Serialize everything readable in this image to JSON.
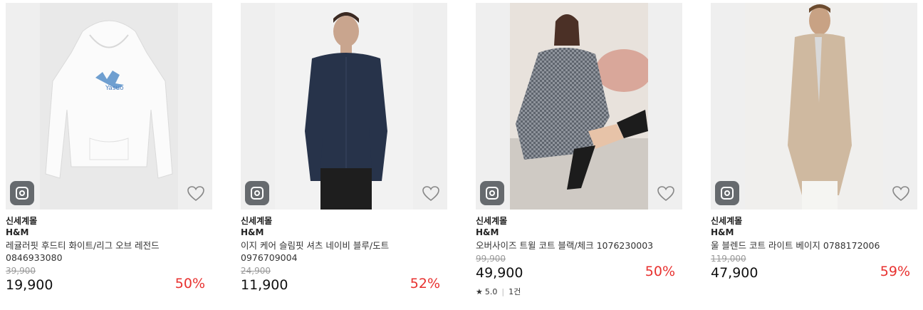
{
  "products": [
    {
      "mall": "신세계몰",
      "brand": "H&M",
      "name": "레귤러핏 후드티 화이트/리그 오브 레전드",
      "code": "0846933080",
      "original_price": "39,900",
      "price": "19,900",
      "discount": "50%",
      "rating": null,
      "review_count": null
    },
    {
      "mall": "신세계몰",
      "brand": "H&M",
      "name": "이지 케어 슬림핏 셔츠 네이비 블루/도트",
      "code": "0976709004",
      "original_price": "24,900",
      "price": "11,900",
      "discount": "52%",
      "rating": null,
      "review_count": null
    },
    {
      "mall": "신세계몰",
      "brand": "H&M",
      "name": "오버사이즈 트윌 코트 블랙/체크 1076230003",
      "code": "",
      "original_price": "99,900",
      "price": "49,900",
      "discount": "50%",
      "rating": "5.0",
      "review_count": "1건"
    },
    {
      "mall": "신세계몰",
      "brand": "H&M",
      "name": "울 블렌드 코트 라이트 베이지 0788172006",
      "code": "",
      "original_price": "119,000",
      "price": "47,900",
      "discount": "59%",
      "rating": null,
      "review_count": null
    }
  ],
  "colors": {
    "discount": "#e8312f",
    "insta_button": "#666a6e",
    "thumb_bg": "#efefef"
  },
  "icons": {
    "image_search": "instagram-camera-icon",
    "wishlist": "heart-outline-icon",
    "rating": "star-icon"
  }
}
